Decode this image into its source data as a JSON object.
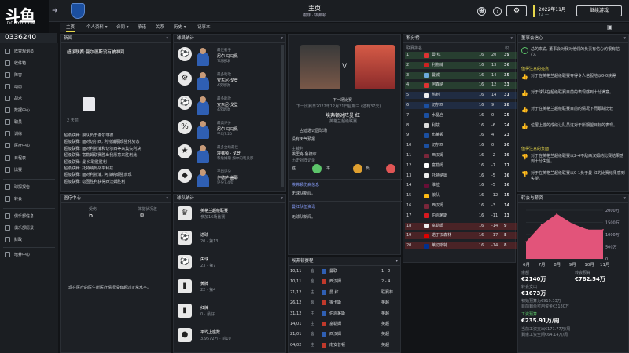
{
  "topbar": {
    "title": "主页",
    "subtitle": "谢菲 · 埃弗顿",
    "date_line1": "2022年11月",
    "date_line2": "14 一",
    "continue_label": "继续游戏",
    "gear": "⚙",
    "icon_person": "☻",
    "icon_help": "?"
  },
  "brand": {
    "logo_cn": "斗鱼",
    "logo_en": "DOUYU.COM",
    "room_id": "0336240"
  },
  "sidebar": {
    "items": [
      "阵容规划员",
      "收件箱",
      "阵容",
      "动态",
      "战术",
      "数据中心",
      "职员",
      "训练",
      "医疗中心",
      "日程表",
      "比赛",
      "球探报告",
      "转会",
      "俱乐部信息",
      "俱乐部愿景",
      "财政",
      "培养中心"
    ]
  },
  "tabs": [
    "主页",
    "个人资料 ▾",
    "合同 ▾",
    "承诺",
    "关系",
    "历史 ▾",
    "记事本"
  ],
  "news": {
    "header": "新闻",
    "headline": "超级联赛:曼尔德斯没有被准到",
    "ago": "2 天前",
    "items": [
      "超级联赛: 狼队负于谢尔菲德",
      "超级联赛: 面对切尔西, 利物浦展现强化势态",
      "超级联赛: 面对利物浦和切尔西等来集失利决",
      "超级联赛: 富勒姆联赛胜出我愿意来胜利此",
      "超级联赛: 曼 红取胜胜利",
      "超级联赛: 托特纳姆战平利兹",
      "超级联赛: 面对利物浦, 阿森纳顽强表现",
      "超级联赛: 稳固胜利获得西汉姆胜利"
    ]
  },
  "medical": {
    "header": "医疗中心",
    "col1_label": "受伤",
    "col1_value": "6",
    "col2_label": "体能状况差",
    "col2_value": "0",
    "footer": "现在医疗的医生所医疗情况没有超过正常水平。"
  },
  "stats": {
    "header": "球员统计",
    "items": [
      {
        "t1": "最佳射手",
        "t2": "尼尔·马马佩",
        "t3": "7场进球"
      },
      {
        "t1": "最多助攻",
        "t2": "安东尼·戈登",
        "t3": "4次助攻"
      },
      {
        "t1": "最多助攻",
        "t2": "安东尼·戈登",
        "t3": "4次助攻"
      },
      {
        "t1": "最高评分",
        "t2": "尼尔·马马佩",
        "t3": "平均7.20"
      },
      {
        "t1": "最多全场最佳",
        "t2": "埃弗顿 · 戈登",
        "t3": "和詹姆斯·加尔内利关那"
      },
      {
        "t1": "平均评分",
        "t2": "伊德萨·盖耶",
        "t3": "评分7.4次"
      }
    ]
  },
  "teamstats": {
    "header": "球队统计",
    "items": [
      {
        "icon": "♛",
        "t1": "英格兰超级联赛",
        "t2": "参加16场比赛"
      },
      {
        "icon": "⚽",
        "t1": "进球",
        "t2": "20 · 第13"
      },
      {
        "icon": "⚽",
        "t1": "失球",
        "t2": "23 · 第7"
      },
      {
        "icon": "▮",
        "t1": "黄牌",
        "t2": "22 · 第4"
      },
      {
        "icon": "▮",
        "t1": "红牌",
        "t2": "0 · 最好"
      },
      {
        "icon": "●",
        "t1": "平均上座数",
        "t2": "3.9572万 · 前10"
      }
    ]
  },
  "nextmatch": {
    "label": "下一场比赛",
    "when": "下一比赛日2022年12月21日星期三 (还有37天)",
    "teams": "埃弗顿对阵曼 红",
    "stadium": "古迪逊公园球场",
    "weather": "没有天气预报",
    "comp": "英格兰超级联赛",
    "ref_label": "主裁判",
    "ref": "埃里克·鲁德尔",
    "record_label": "历史对阵记录",
    "w": "胜",
    "d": "平",
    "l": "负",
    "vs": "V"
  },
  "injury": {
    "header": "埃弗顿伤病信息",
    "text": "无球队新闻。",
    "header2": "曼红队伍资讯",
    "text2": "无球队新闻。"
  },
  "fixtures": {
    "header": "埃弗顿赛程",
    "rows": [
      {
        "d": "10/11",
        "ha": "客",
        "team": "曼联",
        "res": "1 - 0"
      },
      {
        "d": "10/11",
        "ha": "客",
        "team": "西汉姆",
        "res": "2 - 4"
      },
      {
        "d": "21/12",
        "ha": "主",
        "team": "曼 红",
        "res": "联赛杯"
      },
      {
        "d": "26/12",
        "ha": "客",
        "team": "狼卡斯",
        "res": "英超"
      },
      {
        "d": "31/12",
        "ha": "主",
        "team": "伯恩茅斯",
        "res": "英超"
      },
      {
        "d": "14/01",
        "ha": "主",
        "team": "富勒姆",
        "res": "英超"
      },
      {
        "d": "21/01",
        "ha": "客",
        "team": "西汉姆",
        "res": "英超"
      },
      {
        "d": "04/02",
        "ha": "主",
        "team": "南安普顿",
        "res": "英超"
      }
    ]
  },
  "table": {
    "header": "积分榜",
    "sub": "联赛排名",
    "cols": [
      "",
      "",
      "",
      "",
      "积"
    ],
    "rows": [
      {
        "p": "1",
        "t": "曼 红",
        "g": "16",
        "d": "20",
        "pts": "39"
      },
      {
        "p": "2",
        "t": "利物浦",
        "g": "16",
        "d": "13",
        "pts": "36"
      },
      {
        "p": "3",
        "t": "曼城",
        "g": "16",
        "d": "14",
        "pts": "35"
      },
      {
        "p": "4",
        "t": "阿森纳",
        "g": "16",
        "d": "12",
        "pts": "33"
      },
      {
        "p": "5",
        "t": "热刺",
        "g": "16",
        "d": "14",
        "pts": "31"
      },
      {
        "p": "6",
        "t": "切尔西",
        "g": "16",
        "d": "9",
        "pts": "28"
      },
      {
        "p": "7",
        "t": "水晶宫",
        "g": "16",
        "d": "0",
        "pts": "25"
      },
      {
        "p": "8",
        "t": "利兹",
        "g": "16",
        "d": "-6",
        "pts": "24"
      },
      {
        "p": "9",
        "t": "布莱顿",
        "g": "16",
        "d": "4",
        "pts": "23"
      },
      {
        "p": "10",
        "t": "切尔西",
        "g": "16",
        "d": "0",
        "pts": "20"
      },
      {
        "p": "11",
        "t": "西汉姆",
        "g": "16",
        "d": "-2",
        "pts": "19"
      },
      {
        "p": "12",
        "t": "富勒姆",
        "g": "16",
        "d": "-7",
        "pts": "17"
      },
      {
        "p": "13",
        "t": "托特纳姆",
        "g": "16",
        "d": "-5",
        "pts": "16"
      },
      {
        "p": "14",
        "t": "维拉",
        "g": "16",
        "d": "-5",
        "pts": "16"
      },
      {
        "p": "15",
        "t": "狼队",
        "g": "16",
        "d": "-12",
        "pts": "15"
      },
      {
        "p": "16",
        "t": "西汉姆",
        "g": "16",
        "d": "-3",
        "pts": "14"
      },
      {
        "p": "17",
        "t": "伯恩茅斯",
        "g": "16",
        "d": "-11",
        "pts": "13"
      },
      {
        "p": "18",
        "t": "富勒姆",
        "g": "16",
        "d": "-14",
        "pts": "9"
      },
      {
        "p": "19",
        "t": "诺丁汉森林",
        "g": "16",
        "d": "-17",
        "pts": "8"
      },
      {
        "p": "20",
        "t": "莱切斯特",
        "g": "16",
        "d": "-14",
        "pts": "8"
      }
    ]
  },
  "board": {
    "header": "董事会信心",
    "intro": "总的来说, 董事会对我对他们的负责有信心的很有信心。",
    "pos_header": "值得注意的亮点",
    "pos": [
      "对于在英格兰超级联赛夺得令人信服地以0-0获得",
      "对于球队在超级联赛目前的表现感到十分满意。",
      "对于在英格兰超级联赛目前的情况下而跟踪比较",
      "位居上游的成绩让队员这对于所期望目标的表现。"
    ],
    "neg_header": "值得注意的负面",
    "neg": [
      "对于在英格兰超级联赛以2-4不敌西汉姆的比赛结果感到十分失望。",
      "对于在英格兰超级联赛以0-1负于曼 红的比赛结果感到失望。"
    ]
  },
  "finance": {
    "header": "转会与薪资",
    "balance_label": "余额",
    "balance": "€2140万",
    "transfer_label": "转会预算",
    "transfer": "€782.54万",
    "spent_label": "转会支出",
    "spent": "€1673万",
    "spent_note": "初始预算为€919.33万",
    "remain_note": "目前剩余可用资金€3180万",
    "wage_label": "工资预算",
    "wage": "€235.91万/周",
    "wage_note1": "当前工资支出€171.77万/周",
    "wage_note2": "剩余工资空间€64.14万/周"
  },
  "chart_data": {
    "type": "area",
    "categories": [
      "6月",
      "7月",
      "8月",
      "9月",
      "10月",
      "11月"
    ],
    "values": [
      700,
      1400,
      1850,
      1450,
      1200,
      1200
    ],
    "yticks": [
      "2000万",
      "1500万",
      "1000万",
      "500万",
      "0"
    ],
    "ylim": [
      0,
      2000
    ]
  }
}
